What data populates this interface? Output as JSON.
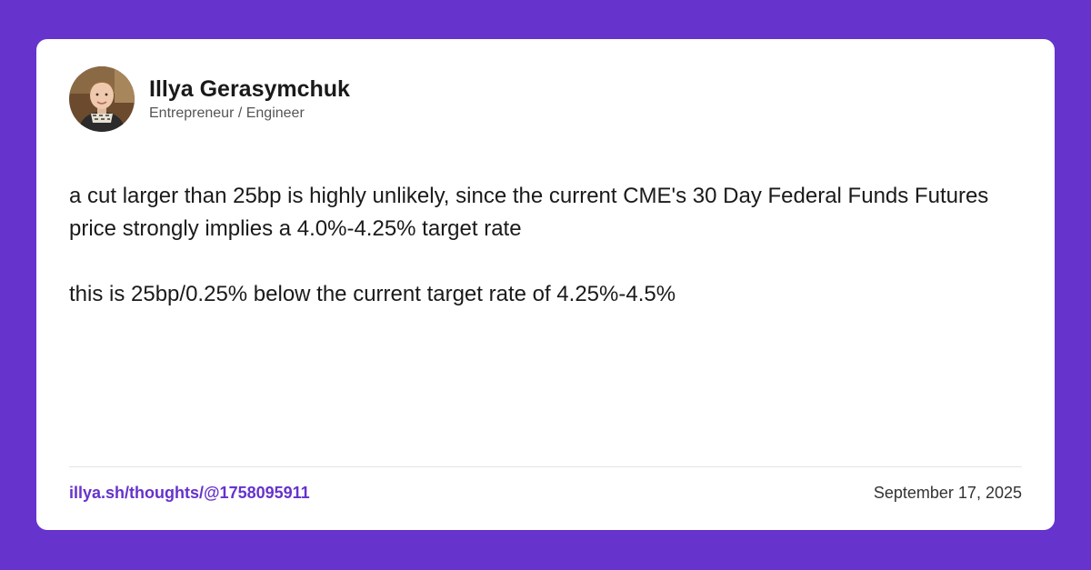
{
  "colors": {
    "background": "#6633cc",
    "card": "#ffffff",
    "text": "#1a1a1a",
    "subtle_text": "#555555",
    "link": "#6633cc",
    "divider": "#e3e3e3"
  },
  "author": {
    "name": "Illya Gerasymchuk",
    "title": "Entrepreneur / Engineer",
    "avatar_icon": "avatar-photo"
  },
  "post": {
    "paragraphs": [
      "a cut larger than 25bp is highly unlikely, since the current CME's 30 Day Federal Funds Futures price strongly implies a 4.0%-4.25% target rate",
      "this is 25bp/0.25% below the current target rate of 4.25%-4.5%"
    ]
  },
  "footer": {
    "link_text": "illya.sh/thoughts/@1758095911",
    "date": "September 17, 2025"
  }
}
